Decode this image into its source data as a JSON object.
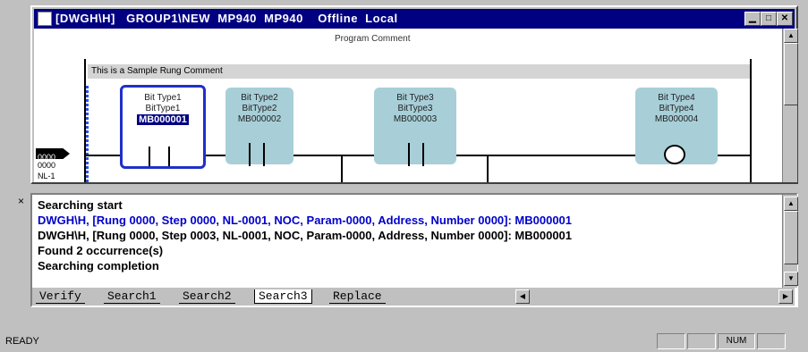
{
  "window": {
    "title": "[DWGH\\H]   GROUP1\\NEW  MP940  MP940    Offline  Local",
    "min_glyph": "▁",
    "max_glyph": "□",
    "close_glyph": "✕"
  },
  "ladder": {
    "program_comment": "Program Comment",
    "rung_comment": "This is a Sample Rung Comment",
    "step_number": "0000",
    "step_lines": [
      "0000",
      "NL-1"
    ],
    "elements": [
      {
        "type_line1": "Bit Type1",
        "type_line2": "BitType1",
        "address": "MB000001"
      },
      {
        "type_line1": "Bit Type2",
        "type_line2": "BitType2",
        "address": "MB000002"
      },
      {
        "type_line1": "Bit Type3",
        "type_line2": "BitType3",
        "address": "MB000003"
      },
      {
        "type_line1": "Bit Type4",
        "type_line2": "BitType4",
        "address": "MB000004"
      }
    ]
  },
  "output": {
    "lines": [
      {
        "text": "Searching start",
        "color": "#000000"
      },
      {
        "text": "DWGH\\H, [Rung 0000, Step 0000, NL-0001, NOC, Param-0000, Address, Number 0000]: MB000001",
        "color": "#0000cc"
      },
      {
        "text": "DWGH\\H, [Rung 0000, Step 0003, NL-0001, NOC, Param-0000, Address, Number 0000]: MB000001",
        "color": "#000000"
      },
      {
        "text": "Found 2 occurrence(s)",
        "color": "#000000"
      },
      {
        "text": "Searching completion",
        "color": "#000000"
      }
    ],
    "tabs": [
      "Verify",
      "Search1",
      "Search2",
      "Search3",
      "Replace"
    ],
    "active_tab": "Search3"
  },
  "status": {
    "text": "READY",
    "num": "NUM"
  },
  "colors": {
    "title_bg": "#000080",
    "element_fill": "#a8cfd8",
    "selection": "#2030c8"
  }
}
